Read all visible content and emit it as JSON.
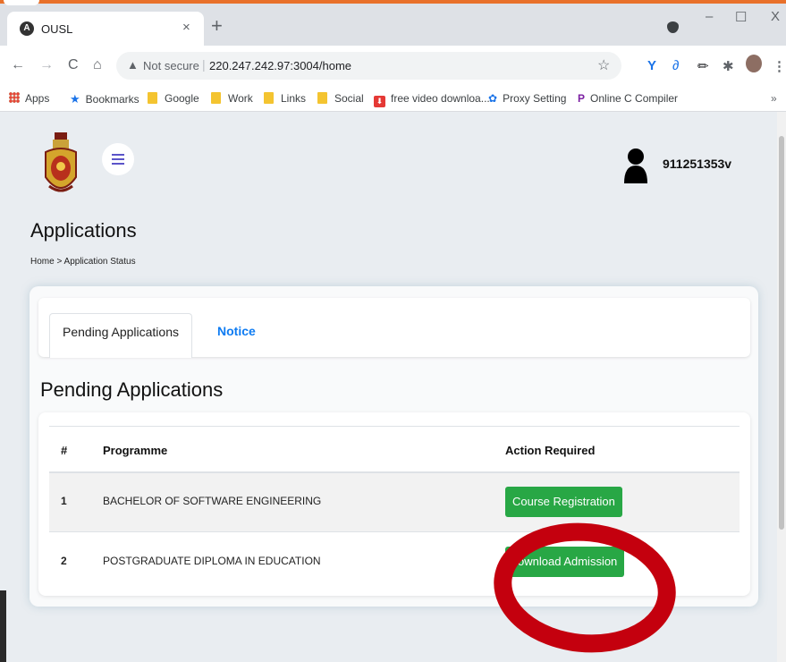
{
  "browser": {
    "tab_title": "OUSL",
    "tab_favicon": "A",
    "close_glyph": "×",
    "newtab_glyph": "+",
    "window": {
      "minimize": "–",
      "maximize": "☐",
      "close": "X"
    },
    "nav": {
      "back": "←",
      "forward": "→",
      "reload": "C",
      "home": "⌂"
    },
    "omnibox": {
      "warning_glyph": "▲",
      "security_text": "Not secure",
      "separator": "|",
      "url": "220.247.242.97:3004/home",
      "star": "☆"
    },
    "extensions": {
      "v": "Y",
      "link": "∂",
      "pen": "✏",
      "puzzle": "✱",
      "menu": "⋮"
    },
    "bookmarks": [
      {
        "label": "Apps"
      },
      {
        "label": "Bookmarks"
      },
      {
        "label": "Google"
      },
      {
        "label": "Work"
      },
      {
        "label": "Links"
      },
      {
        "label": "Social"
      },
      {
        "label": "free video downloa..."
      },
      {
        "label": "Proxy Setting"
      },
      {
        "label": "Online C Compiler"
      }
    ],
    "bookmarks_overflow": "»",
    "red_icon_glyph": "⬇",
    "gear_glyph": "✿",
    "p_glyph": "P",
    "star_glyph": "★"
  },
  "header": {
    "menu_icon": "hamburger-icon",
    "username": "911251353v"
  },
  "page": {
    "title": "Applications",
    "breadcrumb": "Home > Application Status"
  },
  "tabs": [
    {
      "label": "Pending Applications",
      "active": true
    },
    {
      "label": "Notice",
      "active": false
    }
  ],
  "section": {
    "title": "Pending Applications"
  },
  "table": {
    "columns": [
      "#",
      "Programme",
      "Action Required"
    ],
    "rows": [
      {
        "num": "1",
        "programme": "BACHELOR OF SOFTWARE ENGINEERING",
        "action": "Course Registration"
      },
      {
        "num": "2",
        "programme": "POSTGRADUATE DIPLOMA IN EDUCATION",
        "action": "ownload Admission"
      }
    ]
  },
  "colors": {
    "accent_green": "#28a745",
    "link_blue": "#0d7bf2",
    "annotation_red": "#c4000e"
  }
}
